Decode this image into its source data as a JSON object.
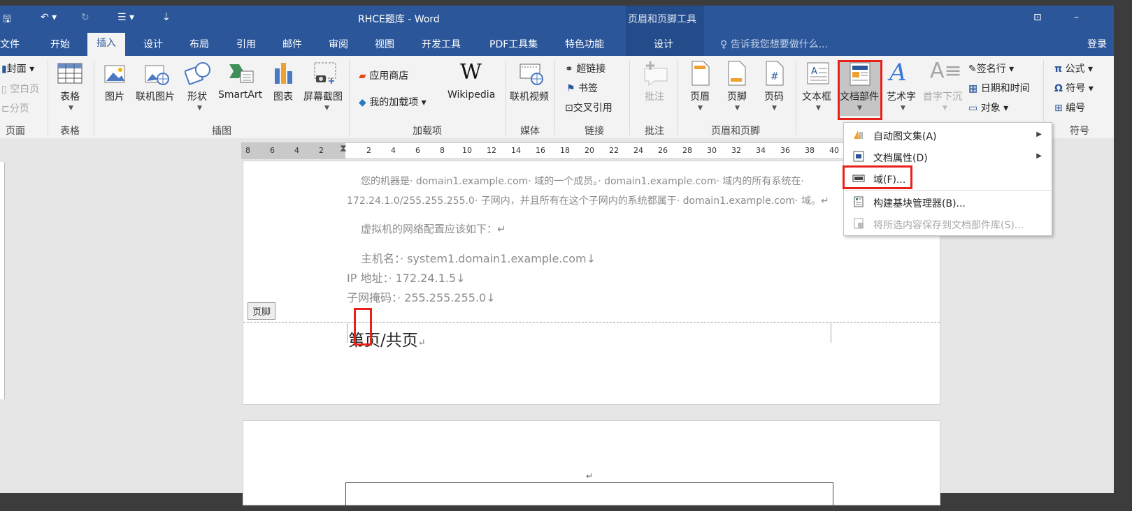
{
  "titlebar": {
    "title": "RHCE题库 - Word",
    "context_tools": "页眉和页脚工具",
    "minimize": "–"
  },
  "tabs": [
    "文件",
    "开始",
    "插入",
    "设计",
    "布局",
    "引用",
    "邮件",
    "审阅",
    "视图",
    "开发工具",
    "PDF工具集",
    "特色功能",
    "设计"
  ],
  "active_tab": "插入",
  "tell_me": "告诉我您想要做什么...",
  "login": "登录",
  "ribbon": {
    "pages": {
      "cover": "封面",
      "blank": "空白页",
      "break": "分页",
      "group": "页面"
    },
    "tables": {
      "table": "表格",
      "group": "表格"
    },
    "illustrations": {
      "picture": "图片",
      "online_picture": "联机图片",
      "shapes": "形状",
      "smartart": "SmartArt",
      "chart": "图表",
      "screenshot": "屏幕截图",
      "group": "插图"
    },
    "addins": {
      "store": "应用商店",
      "my_addins": "我的加载项",
      "wikipedia": "Wikipedia",
      "group": "加载项"
    },
    "media": {
      "online_video": "联机视频",
      "group": "媒体"
    },
    "links": {
      "hyperlink": "超链接",
      "bookmark": "书签",
      "crossref": "交叉引用",
      "group": "链接"
    },
    "comments": {
      "comment": "批注",
      "group": "批注"
    },
    "header_footer": {
      "header": "页眉",
      "footer": "页脚",
      "page_number": "页码",
      "group": "页眉和页脚"
    },
    "text": {
      "textbox": "文本框",
      "quickparts": "文档部件",
      "wordart": "艺术字",
      "dropcap": "首字下沉",
      "signature": "签名行",
      "datetime": "日期和时间",
      "object": "对象"
    },
    "symbols": {
      "equation": "公式",
      "symbol": "符号",
      "number": "编号",
      "group": "符号"
    }
  },
  "ruler_numbers": [
    "8",
    "6",
    "4",
    "2",
    "2",
    "4",
    "6",
    "8",
    "10",
    "12",
    "14",
    "16",
    "18",
    "20",
    "22",
    "24",
    "26",
    "28",
    "30",
    "32",
    "34",
    "36",
    "38",
    "40"
  ],
  "document": {
    "line1": "您的机器是· domain1.example.com· 域的一个成员。· domain1.example.com· 域内的所有系统在·",
    "line2": "172.24.1.0/255.255.255.0· 子网内，并且所有在这个子网内的系统都属于· domain1.example.com· 域。↵",
    "line3": "虚拟机的网络配置应该如下：↵",
    "line4": "主机名：· system1.domain1.example.com↓",
    "line5": "IP 地址：· 172.24.1.5↓",
    "line6": "子网掩码：· 255.255.255.0↓",
    "footer_tag": "页脚",
    "footer_text": "第页/共页",
    "footer_mark": "↵",
    "page2_mark": "↵"
  },
  "menu": {
    "items": [
      {
        "label": "自动图文集(A)",
        "submenu": true,
        "disabled": false
      },
      {
        "label": "文档属性(D)",
        "submenu": true,
        "disabled": false
      },
      {
        "label": "域(F)...",
        "submenu": false,
        "disabled": false
      },
      {
        "label": "构建基块管理器(B)...",
        "submenu": false,
        "disabled": false
      },
      {
        "label": "将所选内容保存到文档部件库(S)...",
        "submenu": false,
        "disabled": true
      }
    ]
  },
  "colors": {
    "word_blue": "#2b579a",
    "highlight_red": "#e8211b"
  }
}
